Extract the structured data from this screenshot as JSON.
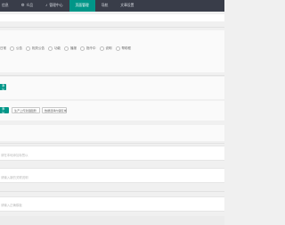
{
  "nav": {
    "items": [
      {
        "label": "信息",
        "icon": ""
      },
      {
        "label": "众品",
        "icon": "⚙"
      },
      {
        "label": "管理中心",
        "icon": "♪"
      },
      {
        "label": "页面管理",
        "icon": ""
      },
      {
        "label": "导航",
        "icon": ""
      },
      {
        "label": "文章设置",
        "icon": ""
      }
    ],
    "active_index": 3
  },
  "radio_group": {
    "lead_label": "日常",
    "options": [
      "公告",
      "相关公告",
      "功能",
      "播报",
      "指令中",
      "说明",
      "帮助框"
    ]
  },
  "buttons": {
    "primary_a": "添加",
    "primary_b": "添加",
    "secondary_c": "生产上传封面图册",
    "secondary_d": "数据选择内容区域"
  },
  "fields": {
    "first_placeholder": "请在本地添加标签以",
    "second_placeholder": "请输入新的关联说明",
    "third_placeholder": "请输入正确模板"
  },
  "colors": {
    "nav_bg": "#393d49",
    "accent": "#009688"
  }
}
